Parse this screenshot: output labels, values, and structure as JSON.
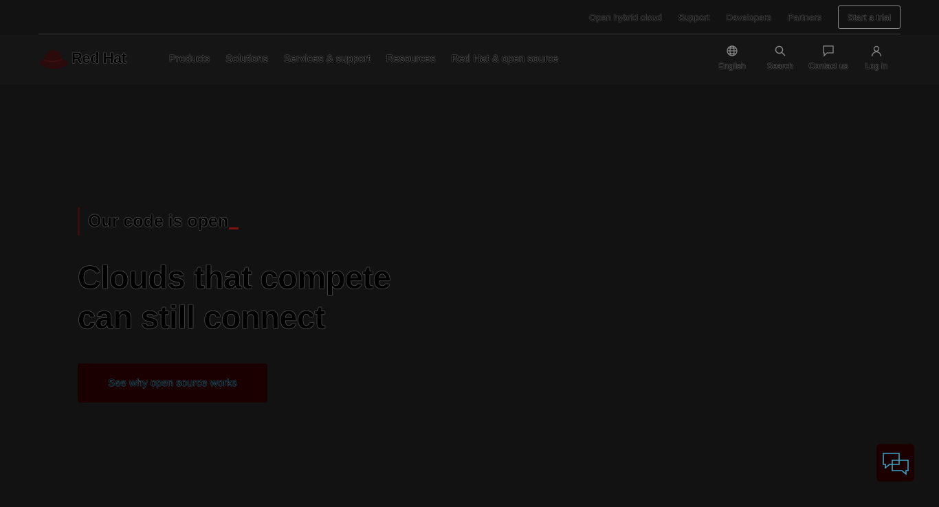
{
  "utility_bar": {
    "links": [
      "Open hybrid cloud",
      "Support",
      "Developers",
      "Partners"
    ],
    "trial_label": "Start a trial"
  },
  "brand": {
    "name": "Red Hat",
    "accent_color": "#7a1212"
  },
  "nav": {
    "items": [
      "Products",
      "Solutions",
      "Services & support",
      "Resources",
      "Red Hat & open source"
    ],
    "tools": [
      {
        "label": "English",
        "icon": "globe-icon"
      },
      {
        "label": "Search",
        "icon": "search-icon"
      },
      {
        "label": "Contact us",
        "icon": "chat-bubble-icon"
      },
      {
        "label": "Log in",
        "icon": "user-icon"
      }
    ]
  },
  "hero": {
    "eyebrow": "Our code is open",
    "headline_lines": [
      "Clouds that compete",
      "can still connect"
    ],
    "cta_label": "See why open source works"
  },
  "chat_widget": {
    "icon": "chat-support-icon"
  }
}
